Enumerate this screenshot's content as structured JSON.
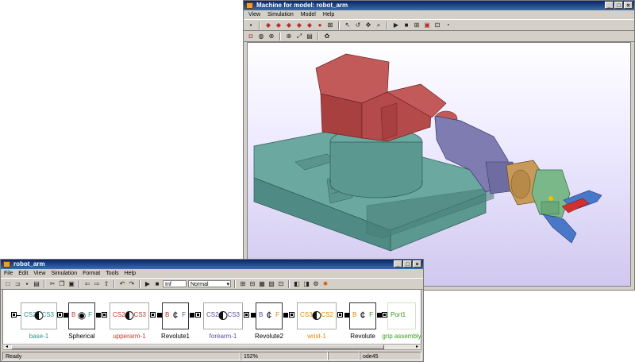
{
  "machine_window": {
    "title": "Machine for model: robot_arm",
    "menu": [
      "View",
      "Simulation",
      "Model",
      "Help"
    ],
    "controls": [
      "_",
      "□",
      "×"
    ]
  },
  "model_window": {
    "title": "robot_arm",
    "menu": [
      "File",
      "Edit",
      "View",
      "Simulation",
      "Format",
      "Tools",
      "Help"
    ],
    "stop_time": "Inf",
    "sim_mode": "Normal",
    "controls": [
      "_",
      "□",
      "×"
    ],
    "status": {
      "left": "Ready",
      "zoom": "152%",
      "solver": "ode45"
    }
  },
  "blocks": [
    {
      "id": "base-1",
      "left_port": "CS2",
      "right_port": "CS3",
      "color": "#2f8f8f"
    },
    {
      "id": "Spherical",
      "left_port": "B",
      "right_port": "F"
    },
    {
      "id": "upperarm-1",
      "left_port": "CS2",
      "right_port": "CS3",
      "color": "#c0392b"
    },
    {
      "id": "Revolute1",
      "left_port": "B",
      "right_port": "F"
    },
    {
      "id": "forearm-1",
      "left_port": "CS2",
      "right_port": "CS3",
      "color": "#5a4fa0"
    },
    {
      "id": "Revolute2",
      "left_port": "B",
      "right_port": "F"
    },
    {
      "id": "wrist-1",
      "left_port": "CS3",
      "right_port": "CS2",
      "color": "#e08a00"
    },
    {
      "id": "Revolute",
      "left_port": "B",
      "right_port": "F"
    },
    {
      "id": "grip assembly",
      "port": "Port1",
      "color": "#3a9a1a"
    }
  ],
  "colors": {
    "base": "#5f9e96",
    "turret": "#b84848",
    "forearm": "#7876a8",
    "wrist": "#c89a5a",
    "grip_body": "#7ab88a",
    "grip_jaw": "#4a78c8",
    "grip_tip": "#d03030"
  }
}
